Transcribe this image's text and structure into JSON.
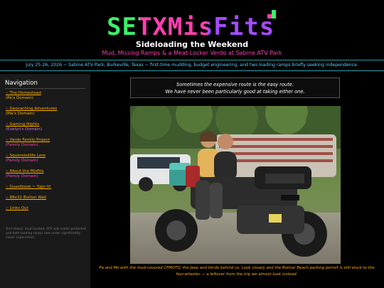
{
  "site": {
    "logo": "SETXMisFits",
    "title": "Sideloading the Weekend",
    "tagline": "Mud, Missing Ramps & a Meat-Locker Verdo at Sabine ATV Park",
    "banner": "July 25-26, 2026 ~ Sabine ATV Park, Burkeville, Texas ~ first-time mudding, budget engineering, and two loading ramps briefly seeking independence."
  },
  "sidebar": {
    "title": "Navigation",
    "items": [
      {
        "label": ":: The Homestead",
        "domain": "(Pa's Domain)"
      },
      {
        "label": ":: Geocaching Adventures",
        "domain": "(Ma's Domain)"
      },
      {
        "label": ":: Gaming Nights",
        "domain": "(Evelyn's Domain)"
      },
      {
        "label": ":: Verdo Family Project",
        "domain": "(Family Domain)"
      },
      {
        "label": ":: Squirrelsdilfe Lore",
        "domain": "(Family Domain)"
      },
      {
        "label": ":: About the MisFits",
        "domain": "(Family Domain)"
      },
      {
        "label": ":: Guestbook ~ Sign It!"
      },
      {
        "label": ":: 88x31 Button Wall"
      },
      {
        "label": ":: Links Out"
      }
    ],
    "footnote": "Trail status: mud located, ATV solo trailer protected and both loading ramps now under significantly closer supervision."
  },
  "quote": {
    "line1": "Sometimes the expensive route is the easy route.",
    "line2": "We have never been particularly good at taking either one."
  },
  "caption": "Pa and Me with the mud-covered CFMOTO, the Jeep and Verdo behind us. Look closely and the Bolivar Beach parking permit is still stuck to the four-wheeler — a leftover from the trip we almost took instead."
}
